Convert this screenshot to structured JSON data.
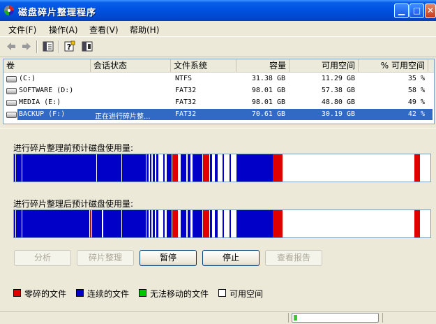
{
  "window": {
    "title": "磁盘碎片整理程序"
  },
  "menu": [
    {
      "label": "文件(F)"
    },
    {
      "label": "操作(A)"
    },
    {
      "label": "查看(V)"
    },
    {
      "label": "帮助(H)"
    }
  ],
  "toolbar": {
    "icons": [
      "back-arrow-icon",
      "forward-arrow-icon",
      "properties-icon",
      "help-icon",
      "show-hide-icon"
    ]
  },
  "volumes": {
    "headers": [
      "卷",
      "会话状态",
      "文件系统",
      "容量",
      "可用空间",
      "% 可用空间"
    ],
    "rows": [
      {
        "volume": "(C:)",
        "status": "",
        "fs": "NTFS",
        "capacity": "31.38 GB",
        "free": "11.29 GB",
        "pct": "35 %"
      },
      {
        "volume": "SOFTWARE (D:)",
        "status": "",
        "fs": "FAT32",
        "capacity": "98.01 GB",
        "free": "57.38 GB",
        "pct": "58 %"
      },
      {
        "volume": "MEDIA (E:)",
        "status": "",
        "fs": "FAT32",
        "capacity": "98.01 GB",
        "free": "48.80 GB",
        "pct": "49 %"
      },
      {
        "volume": "BACKUP (F:)",
        "status": "正在进行碎片整...",
        "fs": "FAT32",
        "capacity": "70.61 GB",
        "free": "30.19 GB",
        "pct": "42 %"
      }
    ]
  },
  "analysis": {
    "before_label": "进行碎片整理前预计磁盘使用量:",
    "after_label": "进行碎片整理后预计磁盘使用量:"
  },
  "buttons": {
    "analyze": "分析",
    "defrag": "碎片整理",
    "pause": "暂停",
    "stop": "停止",
    "report": "查看报告"
  },
  "legend": {
    "fragmented": "零碎的文件",
    "contiguous": "连续的文件",
    "unmovable": "无法移动的文件",
    "free": "可用空间"
  },
  "colors": {
    "fragmented": "#e00000",
    "contiguous": "#0000c8",
    "unmovable": "#00c800",
    "free": "#ffffff",
    "selection": "#316ac5"
  }
}
